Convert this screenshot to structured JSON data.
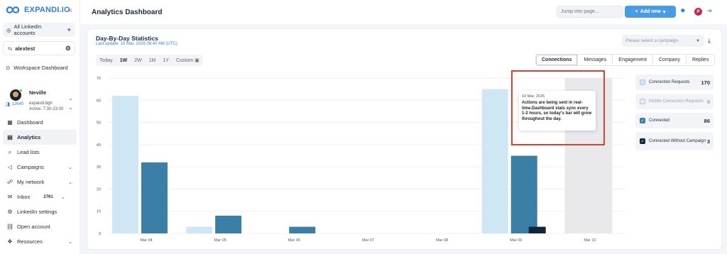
{
  "brand": {
    "name": "EXPANDI.IO",
    "color": "#2f7fd6"
  },
  "sidebar": {
    "accounts_label": "All LinkedIn accounts",
    "current_user": "alextest",
    "workspace_label": "Workspace Dashboard",
    "profile": {
      "name": "Neville",
      "count": "12640",
      "handle": "expandi.bgh",
      "active": "Active: 7:30-23:00"
    },
    "items": [
      {
        "label": "Dashboard",
        "icon": "grid-icon"
      },
      {
        "label": "Analytics",
        "icon": "chart-icon",
        "active": true
      },
      {
        "label": "Lead lists",
        "icon": "search-icon"
      },
      {
        "label": "Campaigns",
        "icon": "megaphone-icon",
        "chevron": true
      },
      {
        "label": "My network",
        "icon": "people-icon",
        "chevron": true
      },
      {
        "label": "Inbox",
        "icon": "inbox-icon",
        "badge": "2761",
        "chevron": true
      },
      {
        "label": "LinkedIn settings",
        "icon": "gear-icon"
      },
      {
        "label": "Open account",
        "icon": "link-icon"
      },
      {
        "label": "Resources",
        "icon": "resources-icon",
        "chevron": true
      }
    ]
  },
  "topbar": {
    "title": "Analytics Dashboard",
    "jump_placeholder": "Jump into page...",
    "add_new": "Add new",
    "avatar_letter": "P"
  },
  "card": {
    "title": "Day-By-Day Statistics",
    "subtitle": "Last update: 10 Mar, 2026 08:40 AM (UTC)",
    "campaign_placeholder": "Please select a campaign",
    "ranges": [
      "Today",
      "1W",
      "2W",
      "1M",
      "1Y",
      "Custom"
    ],
    "active_range": "1W",
    "metric_tabs": [
      "Connections",
      "Messages",
      "Engagement",
      "Company",
      "Replies"
    ],
    "active_tab": "Connections"
  },
  "legend": [
    {
      "label": "Connection Requests",
      "value": "170",
      "color": "#cfe6f5"
    },
    {
      "label": "Mobile Connection Requests",
      "value": "0",
      "color": "#dfeaf3",
      "muted": true
    },
    {
      "label": "Connected",
      "value": "86",
      "color": "#3b7ea6"
    },
    {
      "label": "Connected Without Campaign",
      "value": "3",
      "color": "#12263a"
    }
  ],
  "tooltip": {
    "date": "10 Mar, 2026",
    "message": "Actions are being sent in real-time.Dashboard stats sync every 1-2 hours, so today's bar will grow throughout the day."
  },
  "chart_data": {
    "type": "bar",
    "categories": [
      "Mar 04",
      "Mar 05",
      "Mar 06",
      "Mar 07",
      "Mar 08",
      "Mar 09",
      "Mar 10"
    ],
    "ylim": [
      0,
      70
    ],
    "yticks": [
      0,
      10,
      20,
      30,
      40,
      50,
      60,
      70
    ],
    "grid": true,
    "highlight_category": "Mar 10",
    "series": [
      {
        "name": "Connection Requests",
        "color": "#cfe6f5",
        "values": [
          62,
          3,
          0,
          0,
          0,
          65,
          0
        ]
      },
      {
        "name": "Connected",
        "color": "#3b7ea6",
        "values": [
          32,
          8,
          3,
          0,
          0,
          35,
          0
        ]
      },
      {
        "name": "Connected Without Campaign",
        "color": "#12263a",
        "values": [
          0,
          0,
          0,
          0,
          0,
          3,
          0
        ]
      }
    ]
  }
}
